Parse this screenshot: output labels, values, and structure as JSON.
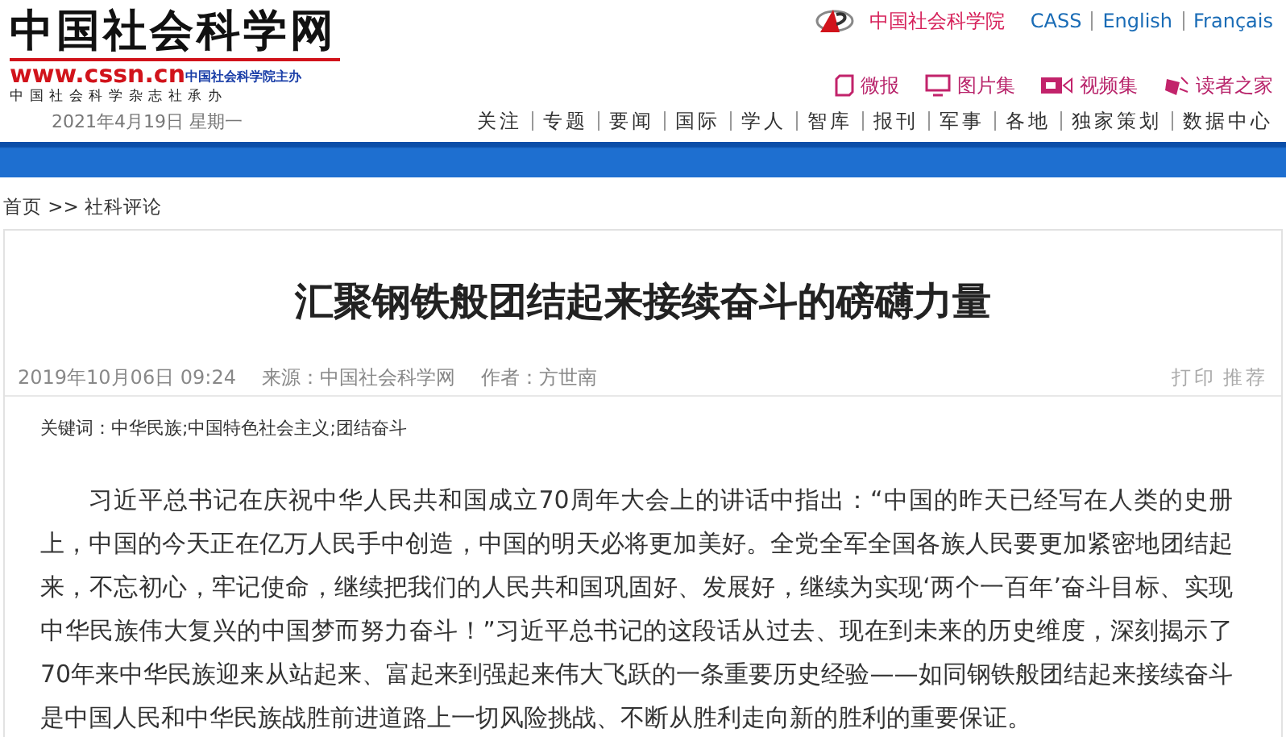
{
  "header": {
    "logo_title": "中国社会科学网",
    "logo_url": "www.cssn.cn",
    "logo_sponsor": "中国社会科学院主办",
    "logo_publisher": "中国社会科学杂志社承办",
    "date": "2021年4月19日 星期一",
    "top_links": [
      {
        "label": "中国社会科学院",
        "kind": "academy"
      },
      {
        "label": "CASS",
        "kind": "lang"
      },
      {
        "label": "English",
        "kind": "lang"
      },
      {
        "label": "Français",
        "kind": "lang"
      }
    ],
    "media_links": [
      {
        "label": "微报",
        "kind": "phone"
      },
      {
        "label": "图片集",
        "kind": "screen"
      },
      {
        "label": "视频集",
        "kind": "video"
      },
      {
        "label": "读者之家",
        "kind": "reader"
      }
    ],
    "nav": [
      "关注",
      "专题",
      "要闻",
      "国际",
      "学人",
      "智库",
      "报刊",
      "军事",
      "各地",
      "独家策划",
      "数据中心"
    ]
  },
  "breadcrumb": [
    "首页",
    ">>",
    "社科评论"
  ],
  "article": {
    "title": "汇聚钢铁般团结起来接续奋斗的磅礴力量",
    "date": "2019年10月06日 09:24",
    "source": "来源：中国社会科学网",
    "author": "作者：方世南",
    "tools": [
      "打印",
      "推荐"
    ],
    "keywords_label": "关键词：",
    "keywords": "中华民族;中国特色社会主义;团结奋斗",
    "paragraphs": [
      "习近平总书记在庆祝中华人民共和国成立70周年大会上的讲话中指出：“中国的昨天已经写在人类的史册上，中国的今天正在亿万人民手中创造，中国的明天必将更加美好。全党全军全国各族人民要更加紧密地团结起来，不忘初心，牢记使命，继续把我们的人民共和国巩固好、发展好，继续为实现‘两个一百年’奋斗目标、实现中华民族伟大复兴的中国梦而努力奋斗！”习近平总书记的这段话从过去、现在到未来的历史维度，深刻揭示了70年来中华民族迎来从站起来、富起来到强起来伟大飞跃的一条重要历史经验——如同钢铁般团结起来接续奋斗是中国人民和中华民族战胜前进道路上一切风险挑战、不断从胜利走向新的胜利的重要保证。"
    ]
  }
}
